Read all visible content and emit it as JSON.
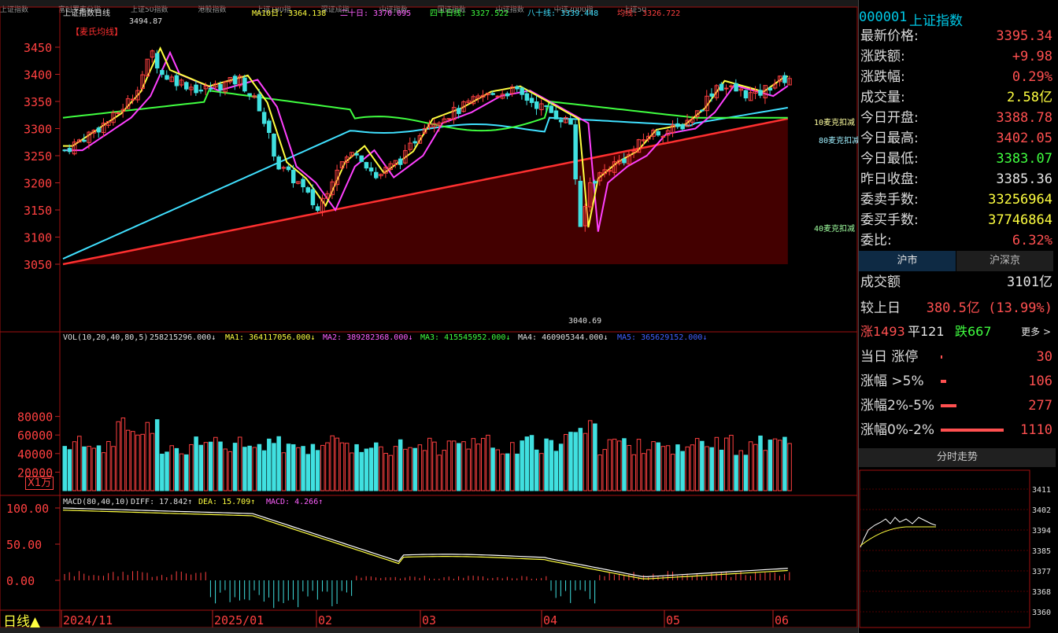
{
  "top_bar": [
    "上证指数",
    "富时罗素分指",
    "上证50指数",
    "港股指数",
    "上证180指",
    "深证成指",
    "中证指数",
    "国证指数",
    "中证指数",
    "中证2000指",
    "上证50"
  ],
  "chart": {
    "ticker": "上证指数日线",
    "ma_header": {
      "ma10": "MA10日: 3364.138",
      "ma20": "二十日: 3370.095",
      "ma40": "四十日线: 3327.522",
      "ma80": "八十线: 3339.448",
      "ma_long": "均线: 3326.722"
    },
    "indicator_tag": "【麦氏均线】",
    "high_label": "3494.87",
    "low_label": "3040.69",
    "kou_labels": [
      "10麦克扣减",
      "80麦克扣减",
      "40麦克扣减"
    ],
    "price_axis": [
      "3450",
      "3400",
      "3350",
      "3300",
      "3250",
      "3200",
      "3150",
      "3100",
      "3050"
    ],
    "vol_header": {
      "title": "VOL(10,20,40,80,5)",
      "vol": "258215296.000↓",
      "ma1": "MA1: 364117056.000↓",
      "ma2": "MA2: 389282368.000↓",
      "ma3": "MA3: 415545952.000↓",
      "ma4": "MA4: 460905344.000↓",
      "ma5": "MA5: 365629152.000↓"
    },
    "vol_axis": [
      "80000",
      "60000",
      "40000",
      "20000"
    ],
    "vol_unit": "X1万",
    "macd_header": {
      "title": "MACD(80,40,10)",
      "diff": "DIFF: 17.842↑",
      "dea": "DEA: 15.709↑",
      "macd": "MACD: 4.266↑"
    },
    "macd_axis": [
      "100.00",
      "50.00",
      "0.00"
    ],
    "period": "日线▲",
    "date_labels": [
      "2024/11",
      "2025/01",
      "02",
      "03",
      "04",
      "05",
      "06"
    ]
  },
  "panel": {
    "code": "000001",
    "name": "上证指数",
    "rows": [
      {
        "label": "最新价格:",
        "value": "3395.34",
        "color": "red"
      },
      {
        "label": "涨跌额:",
        "value": "+9.98",
        "color": "red"
      },
      {
        "label": "涨跌幅:",
        "value": "0.29%",
        "color": "red"
      },
      {
        "label": "成交量:",
        "value": "2.58亿",
        "color": "yel"
      },
      {
        "label": "今日开盘:",
        "value": "3388.78",
        "color": "red"
      },
      {
        "label": "今日最高:",
        "value": "3402.05",
        "color": "red"
      },
      {
        "label": "今日最低:",
        "value": "3383.07",
        "color": "grn"
      },
      {
        "label": "昨日收盘:",
        "value": "3385.36",
        "color": "wht"
      },
      {
        "label": "委卖手数:",
        "value": "33256964",
        "color": "yel"
      },
      {
        "label": "委买手数:",
        "value": "37746864",
        "color": "yel"
      },
      {
        "label": "委比:",
        "value": "6.32%",
        "color": "red"
      }
    ],
    "tabs": [
      "沪市",
      "沪深京"
    ],
    "turnover_label": "成交额",
    "turnover_value": "3101亿",
    "compare_label": "较上日",
    "compare_value": "380.5亿 (13.99%)",
    "breadth": {
      "up": "涨1493",
      "flat": "平121",
      "down": "跌667",
      "more": "更多 >"
    },
    "stats": [
      {
        "label": "当日 涨停",
        "value": "30",
        "bar": 0.01
      },
      {
        "label": "涨幅 >5%",
        "value": "106",
        "bar": 0.09
      },
      {
        "label": "涨幅2%-5%",
        "value": "277",
        "bar": 0.25
      },
      {
        "label": "涨幅0%-2%",
        "value": "1110",
        "bar": 1.0
      }
    ],
    "mini_title": "分时走势",
    "mini_axis": [
      "3411",
      "3402",
      "3394",
      "3385",
      "3377",
      "3368",
      "3360"
    ]
  }
}
